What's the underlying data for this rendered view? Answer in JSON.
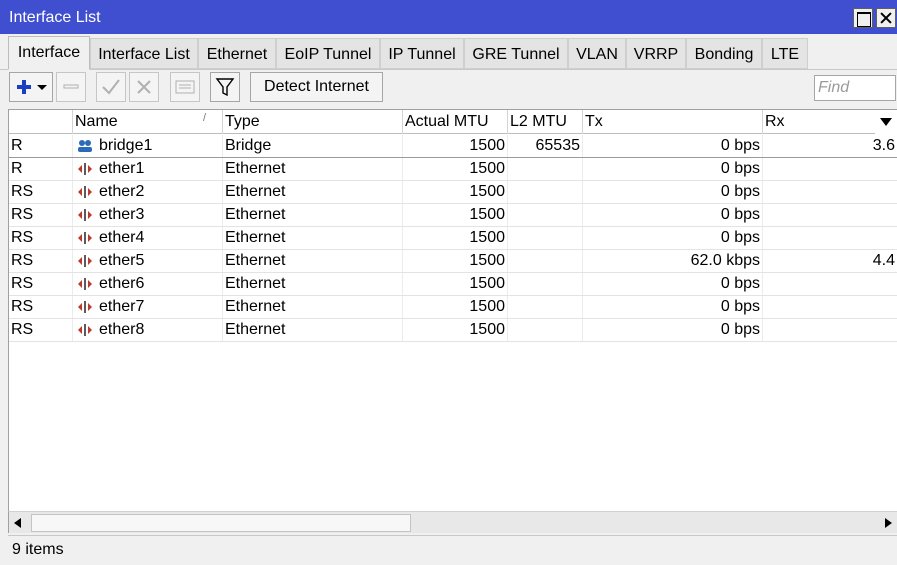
{
  "window": {
    "title": "Interface List"
  },
  "tabs": [
    {
      "label": "Interface",
      "active": true
    },
    {
      "label": "Interface List",
      "active": false
    },
    {
      "label": "Ethernet",
      "active": false
    },
    {
      "label": "EoIP Tunnel",
      "active": false
    },
    {
      "label": "IP Tunnel",
      "active": false
    },
    {
      "label": "GRE Tunnel",
      "active": false
    },
    {
      "label": "VLAN",
      "active": false
    },
    {
      "label": "VRRP",
      "active": false
    },
    {
      "label": "Bonding",
      "active": false
    },
    {
      "label": "LTE",
      "active": false
    }
  ],
  "toolbar": {
    "detect_label": "Detect Internet",
    "find_placeholder": "Find",
    "icons": [
      "add-icon",
      "remove-icon",
      "enable-icon",
      "disable-icon",
      "comment-icon",
      "filter-icon"
    ]
  },
  "columns": [
    "",
    "Name",
    "Type",
    "Actual MTU",
    "L2 MTU",
    "Tx",
    "Rx"
  ],
  "rows": [
    {
      "flags": "R",
      "name": "bridge1",
      "icon": "bridge-icon",
      "type": "Bridge",
      "mtu": "1500",
      "l2mtu": "65535",
      "tx": "0 bps",
      "rx": "3.6"
    },
    {
      "flags": "R",
      "name": "ether1",
      "icon": "ethernet-icon",
      "type": "Ethernet",
      "mtu": "1500",
      "l2mtu": "",
      "tx": "0 bps",
      "rx": ""
    },
    {
      "flags": "RS",
      "name": "ether2",
      "icon": "ethernet-icon",
      "type": "Ethernet",
      "mtu": "1500",
      "l2mtu": "",
      "tx": "0 bps",
      "rx": ""
    },
    {
      "flags": "RS",
      "name": "ether3",
      "icon": "ethernet-icon",
      "type": "Ethernet",
      "mtu": "1500",
      "l2mtu": "",
      "tx": "0 bps",
      "rx": ""
    },
    {
      "flags": "RS",
      "name": "ether4",
      "icon": "ethernet-icon",
      "type": "Ethernet",
      "mtu": "1500",
      "l2mtu": "",
      "tx": "0 bps",
      "rx": ""
    },
    {
      "flags": "RS",
      "name": "ether5",
      "icon": "ethernet-icon",
      "type": "Ethernet",
      "mtu": "1500",
      "l2mtu": "",
      "tx": "62.0 kbps",
      "rx": "4.4"
    },
    {
      "flags": "RS",
      "name": "ether6",
      "icon": "ethernet-icon",
      "type": "Ethernet",
      "mtu": "1500",
      "l2mtu": "",
      "tx": "0 bps",
      "rx": ""
    },
    {
      "flags": "RS",
      "name": "ether7",
      "icon": "ethernet-icon",
      "type": "Ethernet",
      "mtu": "1500",
      "l2mtu": "",
      "tx": "0 bps",
      "rx": ""
    },
    {
      "flags": "RS",
      "name": "ether8",
      "icon": "ethernet-icon",
      "type": "Ethernet",
      "mtu": "1500",
      "l2mtu": "",
      "tx": "0 bps",
      "rx": ""
    }
  ],
  "status": {
    "text": "9 items"
  },
  "colors": {
    "titlebar": "#3f4fd0",
    "add_icon": "#1a3fc0",
    "ethernet_icon": "#c0392b",
    "bridge_icon": "#2a6ab8"
  }
}
